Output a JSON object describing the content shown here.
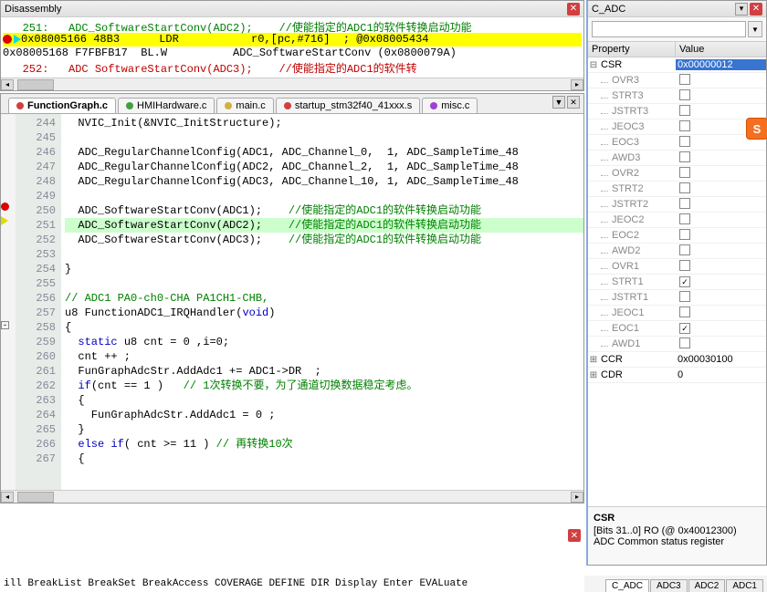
{
  "disasm": {
    "title": "Disassembly",
    "lines": [
      {
        "style": "dl-green",
        "text": "   251:   ADC_SoftwareStartConv(ADC2);    //使能指定的ADC1的软件转换启动功能 "
      },
      {
        "style": "dl-black dl-hl",
        "text": "0x08005166 48B3      LDR           r0,[pc,#716]  ; @0x08005434"
      },
      {
        "style": "dl-black",
        "text": "0x08005168 F7FBFB17  BL.W          ADC_SoftwareStartConv (0x0800079A)"
      },
      {
        "style": "dl-red",
        "text": "   252:   ADC SoftwareStartConv(ADC3);    //使能指定的ADC1的软件转"
      }
    ]
  },
  "editor": {
    "tabs": [
      {
        "label": "FunctionGraph.c",
        "dot": "dot-red",
        "active": true
      },
      {
        "label": "HMIHardware.c",
        "dot": "dot-green",
        "active": false
      },
      {
        "label": "main.c",
        "dot": "dot-yellow",
        "active": false
      },
      {
        "label": "startup_stm32f40_41xxx.s",
        "dot": "dot-red",
        "active": false
      },
      {
        "label": "misc.c",
        "dot": "dot-purple",
        "active": false
      }
    ],
    "tab_menu_label": "▼",
    "tab_close_label": "✕",
    "lines": [
      {
        "n": "244",
        "code": "  NVIC_Init(&NVIC_InitStructure);"
      },
      {
        "n": "245",
        "code": ""
      },
      {
        "n": "246",
        "code": "  ADC_RegularChannelConfig(ADC1, ADC_Channel_0,  1, ADC_SampleTime_48"
      },
      {
        "n": "247",
        "code": "  ADC_RegularChannelConfig(ADC2, ADC_Channel_2,  1, ADC_SampleTime_48"
      },
      {
        "n": "248",
        "code": "  ADC_RegularChannelConfig(ADC3, ADC_Channel_10, 1, ADC_SampleTime_48"
      },
      {
        "n": "249",
        "code": ""
      },
      {
        "n": "250",
        "mark": "bp",
        "code": "  ADC_SoftwareStartConv(ADC1);    <span class='c-green'>//使能指定的ADC1的软件转换启动功能</span>"
      },
      {
        "n": "251",
        "mark": "cur",
        "hl": true,
        "code": "  ADC_SoftwareStartConv(ADC2);    <span class='c-green'>//使能指定的ADC1的软件转换启动功能</span>"
      },
      {
        "n": "252",
        "code": "  ADC_SoftwareStartConv(ADC3);    <span class='c-green'>//使能指定的ADC1的软件转换启动功能</span>"
      },
      {
        "n": "253",
        "code": ""
      },
      {
        "n": "254",
        "code": "}"
      },
      {
        "n": "255",
        "code": ""
      },
      {
        "n": "256",
        "code": "<span class='c-green'>// ADC1 PA0-ch0-CHA PA1CH1-CHB,</span>"
      },
      {
        "n": "257",
        "code": "u8 FunctionADC1_IRQHandler(<span class='c-blue'>void</span>)"
      },
      {
        "n": "258",
        "code": "{",
        "fold": "-"
      },
      {
        "n": "259",
        "code": "  <span class='c-blue'>static</span> u8 cnt = 0 ,i=0;"
      },
      {
        "n": "260",
        "code": "  cnt ++ ;"
      },
      {
        "n": "261",
        "code": "  FunGraphAdcStr.AddAdc1 += ADC1->DR  ;"
      },
      {
        "n": "262",
        "code": "  <span class='c-blue'>if</span>(cnt == 1 )   <span class='c-green'>// 1次转换不要，为了通道切换数据稳定考虑。</span>"
      },
      {
        "n": "263",
        "code": "  {"
      },
      {
        "n": "264",
        "code": "    FunGraphAdcStr.AddAdc1 = 0 ;"
      },
      {
        "n": "265",
        "code": "  }"
      },
      {
        "n": "266",
        "code": "  <span class='c-blue'>else if</span>( cnt >= 11 ) <span class='c-green'>// 再转换10次</span>"
      },
      {
        "n": "267",
        "code": "  {"
      }
    ]
  },
  "cadc": {
    "title": "C_ADC",
    "filter_placeholder": "",
    "head_prop": "Property",
    "head_val": "Value",
    "rows": [
      {
        "tree": "⊟",
        "name": "CSR",
        "val": "0x00000012",
        "sel": true
      },
      {
        "sub": true,
        "name": "OVR3",
        "chk": false
      },
      {
        "sub": true,
        "name": "STRT3",
        "chk": false
      },
      {
        "sub": true,
        "name": "JSTRT3",
        "chk": false
      },
      {
        "sub": true,
        "name": "JEOC3",
        "chk": false
      },
      {
        "sub": true,
        "name": "EOC3",
        "chk": false
      },
      {
        "sub": true,
        "name": "AWD3",
        "chk": false
      },
      {
        "sub": true,
        "name": "OVR2",
        "chk": false
      },
      {
        "sub": true,
        "name": "STRT2",
        "chk": false
      },
      {
        "sub": true,
        "name": "JSTRT2",
        "chk": false
      },
      {
        "sub": true,
        "name": "JEOC2",
        "chk": false
      },
      {
        "sub": true,
        "name": "EOC2",
        "chk": false
      },
      {
        "sub": true,
        "name": "AWD2",
        "chk": false
      },
      {
        "sub": true,
        "name": "OVR1",
        "chk": false
      },
      {
        "sub": true,
        "name": "STRT1",
        "chk": true
      },
      {
        "sub": true,
        "name": "JSTRT1",
        "chk": false
      },
      {
        "sub": true,
        "name": "JEOC1",
        "chk": false
      },
      {
        "sub": true,
        "name": "EOC1",
        "chk": true
      },
      {
        "sub": true,
        "name": "AWD1",
        "chk": false
      },
      {
        "tree": "⊞",
        "name": "CCR",
        "val": "0x00030100"
      },
      {
        "tree": "⊞",
        "name": "CDR",
        "val": "0"
      }
    ],
    "tooltip_title": "CSR",
    "tooltip_l1": "[Bits 31..0] RO (@ 0x40012300)",
    "tooltip_l2": "ADC Common status register",
    "badge": "S"
  },
  "status_tabs": [
    "C_ADC",
    "ADC3",
    "ADC2",
    "ADC1"
  ],
  "active_status_tab": "C_ADC",
  "cmdline": "ill BreakList BreakSet BreakAccess COVERAGE DEFINE DIR Display Enter EVALuate"
}
